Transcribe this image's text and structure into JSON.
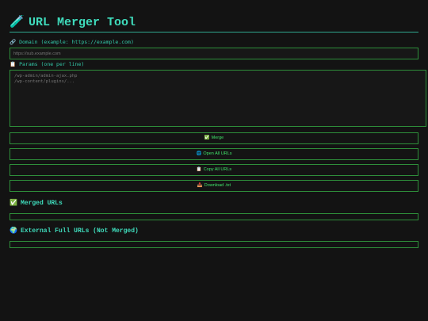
{
  "header": {
    "title": "URL Merger Tool",
    "icon": "🧪"
  },
  "domain": {
    "label": "Domain (example: https://example.com)",
    "icon": "🔗",
    "placeholder": "https://sub.example.com"
  },
  "params": {
    "label": "Params (one per line)",
    "icon": "📋",
    "placeholder": "/wp-admin/admin-ajax.php\n/wp-content/plugins/..."
  },
  "buttons": {
    "merge": {
      "icon": "✅",
      "label": "Merge"
    },
    "open_all": {
      "icon": "🌐",
      "label": "Open All URLs"
    },
    "copy_all": {
      "icon": "📋",
      "label": "Copy All URLs"
    },
    "download": {
      "icon": "📥",
      "label": "Download .txt"
    }
  },
  "merged": {
    "icon": "✅",
    "title": "Merged URLs"
  },
  "external": {
    "icon": "🌍",
    "title": "External Full URLs (Not Merged)"
  }
}
